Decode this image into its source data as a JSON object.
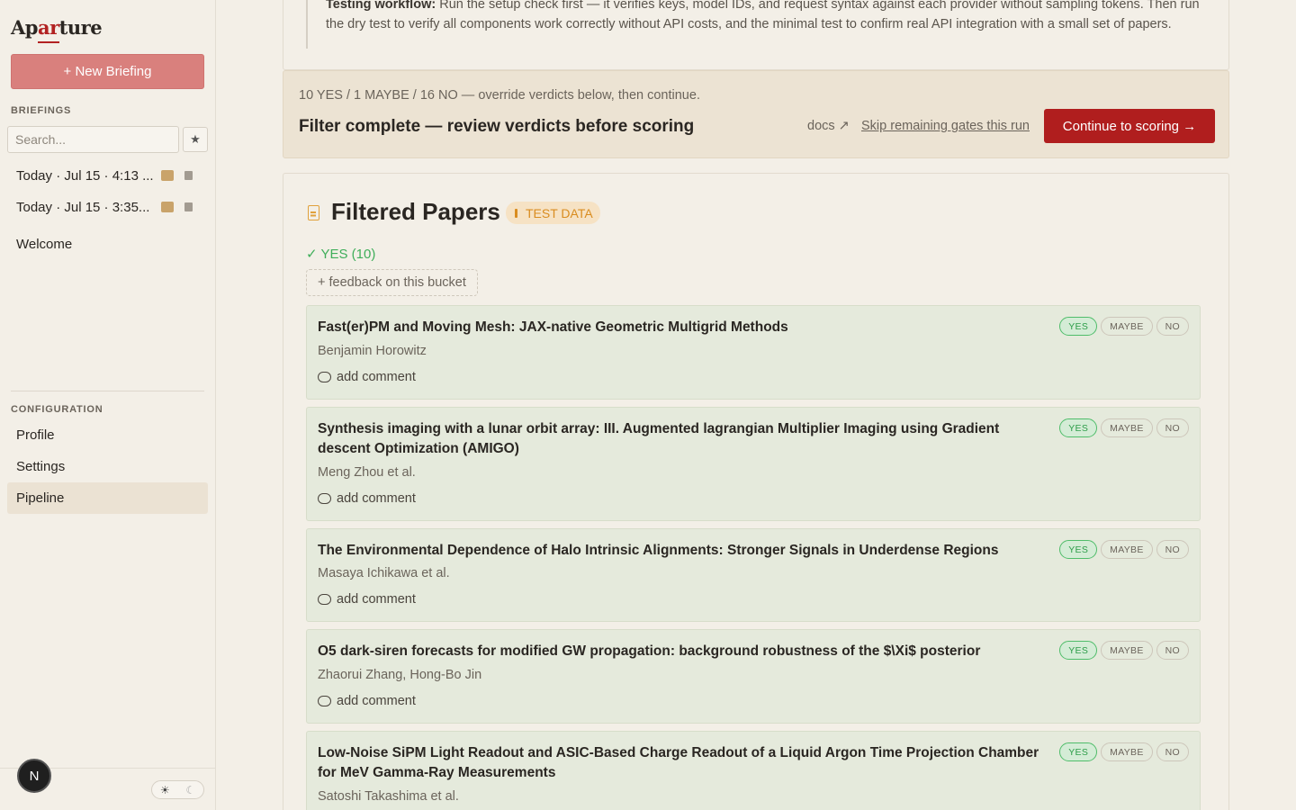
{
  "sidebar": {
    "logo": {
      "pre": "Ap",
      "accent": "ar",
      "post": "ture"
    },
    "new_briefing": "+ New Briefing",
    "briefings_label": "BRIEFINGS",
    "search_placeholder": "Search...",
    "star": "★",
    "briefings": [
      {
        "label": "Today · Jul 15 · 4:13 ..."
      },
      {
        "label": "Today · Jul 15 · 3:35..."
      }
    ],
    "welcome": "Welcome",
    "config_label": "CONFIGURATION",
    "nav": [
      {
        "label": "Profile",
        "active": false
      },
      {
        "label": "Settings",
        "active": false
      },
      {
        "label": "Pipeline",
        "active": true
      }
    ],
    "avatar": "N",
    "theme": {
      "sun": "☀",
      "moon": "☾"
    }
  },
  "workflow": {
    "bold": "Testing workflow:",
    "text": " Run the setup check first — it verifies keys, model IDs, and request syntax against each provider without sampling tokens. Then run the dry test to verify all components work correctly without API costs, and the minimal test to confirm real API integration with a small set of papers."
  },
  "filter": {
    "summary": "10 YES / 1 MAYBE / 16 NO — override verdicts below, then continue.",
    "title": "Filter complete — review verdicts before scoring",
    "docs": "docs ↗",
    "skip": "Skip remaining gates this run",
    "continue": "Continue to scoring →"
  },
  "papers": {
    "heading": "Filtered Papers",
    "badge": "TEST DATA",
    "bucket": "✓ YES (10)",
    "feedback": "+ feedback on this bucket",
    "verdict_labels": {
      "yes": "YES",
      "maybe": "MAYBE",
      "no": "NO"
    },
    "comment": "add comment",
    "items": [
      {
        "title": "Fast(er)PM and Moving Mesh: JAX-native Geometric Multigrid Methods",
        "authors": "Benjamin Horowitz",
        "verdict": "YES"
      },
      {
        "title": "Synthesis imaging with a lunar orbit array: III. Augmented lagrangian Multiplier Imaging using Gradient descent Optimization (AMIGO)",
        "authors": "Meng Zhou et al.",
        "verdict": "YES"
      },
      {
        "title": "The Environmental Dependence of Halo Intrinsic Alignments: Stronger Signals in Underdense Regions",
        "authors": "Masaya Ichikawa et al.",
        "verdict": "YES"
      },
      {
        "title": "O5 dark-siren forecasts for modified GW propagation: background robustness of the $\\Xi$ posterior",
        "authors": "Zhaorui Zhang, Hong-Bo Jin",
        "verdict": "YES"
      },
      {
        "title": "Low-Noise SiPM Light Readout and ASIC-Based Charge Readout of a Liquid Argon Time Projection Chamber for MeV Gamma-Ray Measurements",
        "authors": "Satoshi Takashima et al.",
        "verdict": "YES"
      }
    ]
  }
}
